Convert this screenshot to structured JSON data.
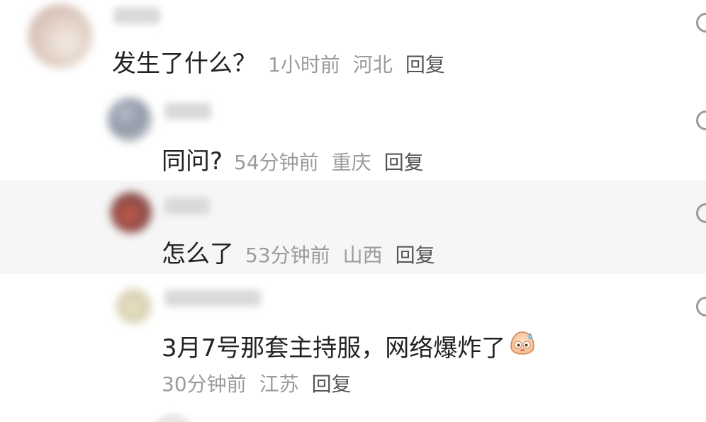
{
  "comments": [
    {
      "content": "发生了什么？",
      "time": "1小时前",
      "location": "河北",
      "reply_label": "回复"
    },
    {
      "content": "同问?",
      "time": "54分钟前",
      "location": "重庆",
      "reply_label": "回复"
    },
    {
      "content": "怎么了",
      "time": "53分钟前",
      "location": "山西",
      "reply_label": "回复"
    },
    {
      "content": "3月7号那套主持服，网络爆炸了",
      "time": "30分钟前",
      "location": "江苏",
      "reply_label": "回复",
      "emoji": "sweating-face-emoji"
    }
  ],
  "icons": {
    "like": "like-circle-icon"
  },
  "colors": {
    "content_text": "#222222",
    "meta_text": "#9b9b9b",
    "reply_text": "#555555",
    "highlight_bg": "#f6f6f6"
  }
}
